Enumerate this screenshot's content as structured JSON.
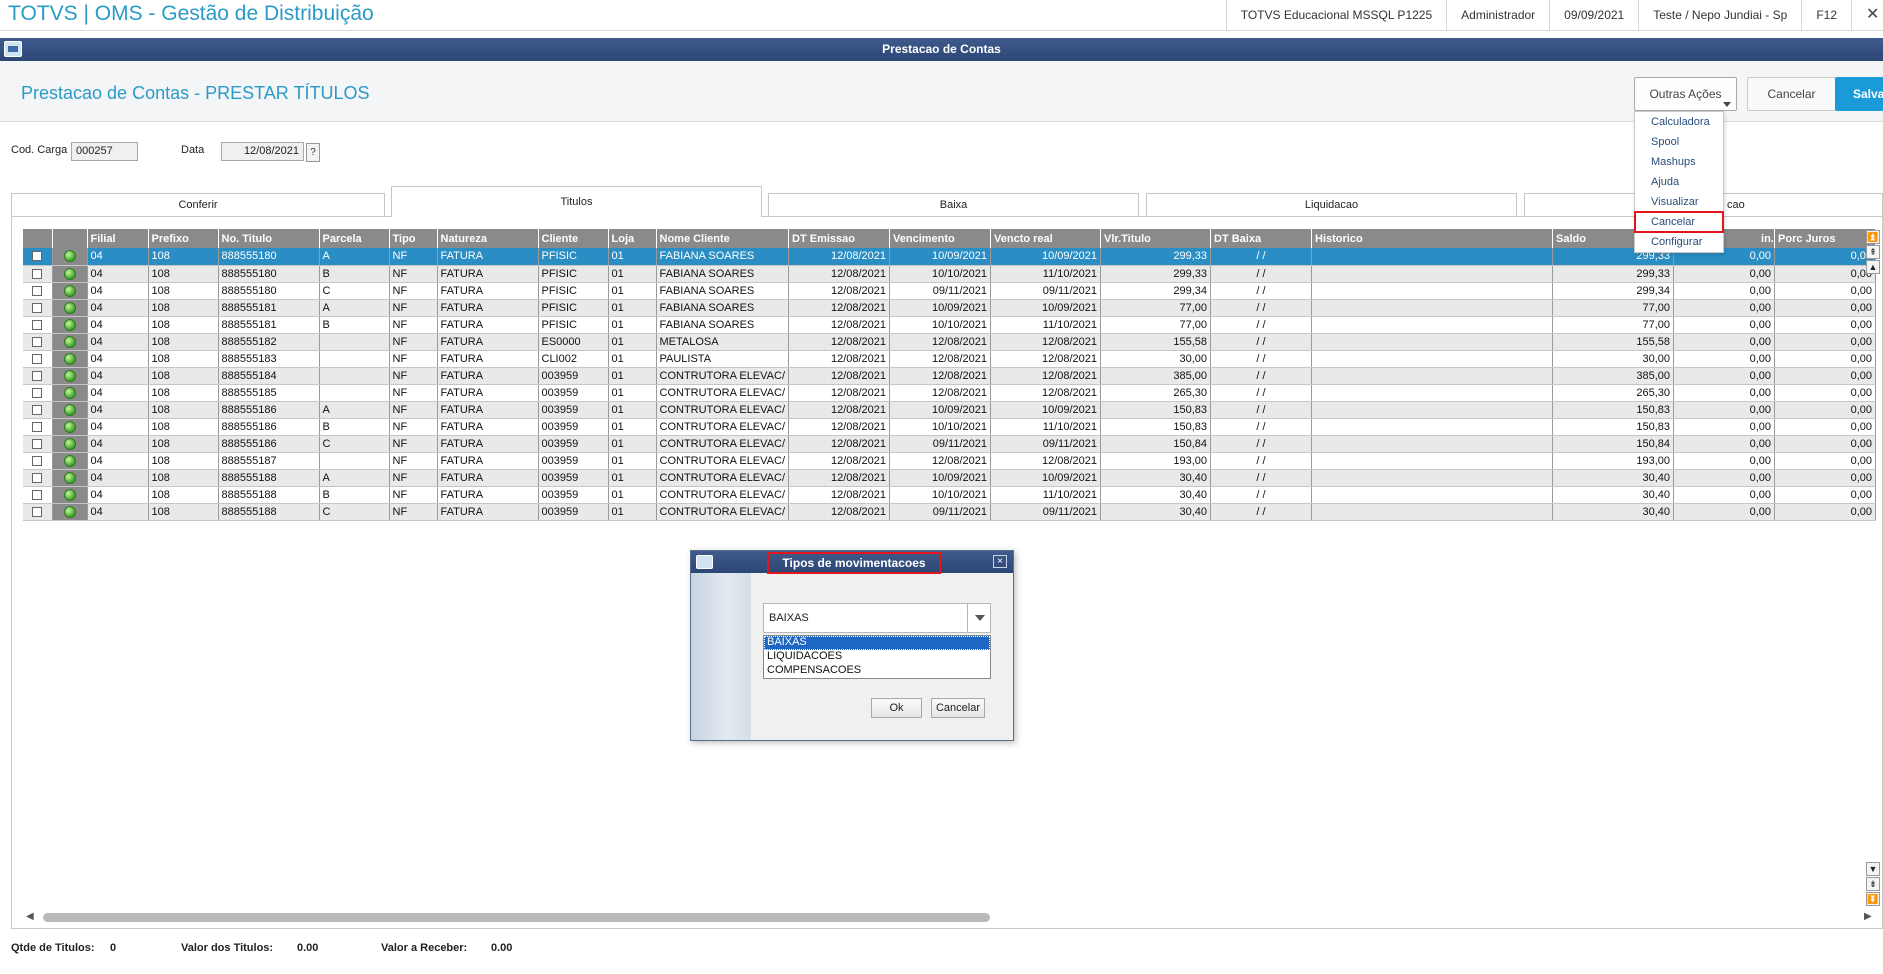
{
  "app": {
    "title": "TOTVS | OMS - Gestão de Distribuição"
  },
  "status_bar": [
    "TOTVS Educacional MSSQL P1225",
    "Administrador",
    "09/09/2021",
    "Teste / Nepo Jundiai - Sp",
    "F12"
  ],
  "window": {
    "title": "Prestacao de Contas"
  },
  "header": {
    "title": "Prestacao de Contas - PRESTAR TÍTULOS",
    "outras_acoes_label": "Outras Ações",
    "cancelar_label": "Cancelar",
    "salvar_label": "Salvar"
  },
  "menu": {
    "items": [
      "Calculadora",
      "Spool",
      "Mashups",
      "Ajuda",
      "Visualizar",
      "Cancelar",
      "Configurar"
    ],
    "highlighted": "Cancelar"
  },
  "form": {
    "cod_carga_label": "Cod. Carga",
    "cod_carga_value": "000257",
    "data_label": "Data",
    "data_value": "12/08/2021",
    "help_label": "?"
  },
  "tabs": [
    {
      "label": "Conferir",
      "active": false
    },
    {
      "label": "Titulos",
      "active": true
    },
    {
      "label": "Baixa",
      "active": false
    },
    {
      "label": "Liquidacao",
      "active": false
    },
    {
      "label": "cao",
      "active": false
    }
  ],
  "grid": {
    "columns": [
      "Filial",
      "Prefixo",
      "No. Titulo",
      "Parcela",
      "Tipo",
      "Natureza",
      "Cliente",
      "Loja",
      "Nome Cliente",
      "DT Emissao",
      "Vencimento",
      "Vencto real",
      "Vlr.Titulo",
      "DT Baixa",
      "Historico",
      "Saldo",
      "in.",
      "Porc Juros"
    ],
    "rows": [
      [
        "04",
        "108",
        "888555180",
        "A",
        "NF",
        "FATURA",
        "PFISIC",
        "01",
        "FABIANA SOARES",
        "12/08/2021",
        "10/09/2021",
        "10/09/2021",
        "299,33",
        " /  /",
        "",
        "299,33",
        "0,00",
        "0,00"
      ],
      [
        "04",
        "108",
        "888555180",
        "B",
        "NF",
        "FATURA",
        "PFISIC",
        "01",
        "FABIANA SOARES",
        "12/08/2021",
        "10/10/2021",
        "11/10/2021",
        "299,33",
        " /  /",
        "",
        "299,33",
        "0,00",
        "0,00"
      ],
      [
        "04",
        "108",
        "888555180",
        "C",
        "NF",
        "FATURA",
        "PFISIC",
        "01",
        "FABIANA SOARES",
        "12/08/2021",
        "09/11/2021",
        "09/11/2021",
        "299,34",
        " /  /",
        "",
        "299,34",
        "0,00",
        "0,00"
      ],
      [
        "04",
        "108",
        "888555181",
        "A",
        "NF",
        "FATURA",
        "PFISIC",
        "01",
        "FABIANA SOARES",
        "12/08/2021",
        "10/09/2021",
        "10/09/2021",
        "77,00",
        " /  /",
        "",
        "77,00",
        "0,00",
        "0,00"
      ],
      [
        "04",
        "108",
        "888555181",
        "B",
        "NF",
        "FATURA",
        "PFISIC",
        "01",
        "FABIANA SOARES",
        "12/08/2021",
        "10/10/2021",
        "11/10/2021",
        "77,00",
        " /  /",
        "",
        "77,00",
        "0,00",
        "0,00"
      ],
      [
        "04",
        "108",
        "888555182",
        "",
        "NF",
        "FATURA",
        "ES0000",
        "01",
        "METALOSA",
        "12/08/2021",
        "12/08/2021",
        "12/08/2021",
        "155,58",
        " /  /",
        "",
        "155,58",
        "0,00",
        "0,00"
      ],
      [
        "04",
        "108",
        "888555183",
        "",
        "NF",
        "FATURA",
        "CLI002",
        "01",
        "PAULISTA",
        "12/08/2021",
        "12/08/2021",
        "12/08/2021",
        "30,00",
        " /  /",
        "",
        "30,00",
        "0,00",
        "0,00"
      ],
      [
        "04",
        "108",
        "888555184",
        "",
        "NF",
        "FATURA",
        "003959",
        "01",
        "CONTRUTORA ELEVAC/",
        "12/08/2021",
        "12/08/2021",
        "12/08/2021",
        "385,00",
        " /  /",
        "",
        "385,00",
        "0,00",
        "0,00"
      ],
      [
        "04",
        "108",
        "888555185",
        "",
        "NF",
        "FATURA",
        "003959",
        "01",
        "CONTRUTORA ELEVAC/",
        "12/08/2021",
        "12/08/2021",
        "12/08/2021",
        "265,30",
        " /  /",
        "",
        "265,30",
        "0,00",
        "0,00"
      ],
      [
        "04",
        "108",
        "888555186",
        "A",
        "NF",
        "FATURA",
        "003959",
        "01",
        "CONTRUTORA ELEVAC/",
        "12/08/2021",
        "10/09/2021",
        "10/09/2021",
        "150,83",
        " /  /",
        "",
        "150,83",
        "0,00",
        "0,00"
      ],
      [
        "04",
        "108",
        "888555186",
        "B",
        "NF",
        "FATURA",
        "003959",
        "01",
        "CONTRUTORA ELEVAC/",
        "12/08/2021",
        "10/10/2021",
        "11/10/2021",
        "150,83",
        " /  /",
        "",
        "150,83",
        "0,00",
        "0,00"
      ],
      [
        "04",
        "108",
        "888555186",
        "C",
        "NF",
        "FATURA",
        "003959",
        "01",
        "CONTRUTORA ELEVAC/",
        "12/08/2021",
        "09/11/2021",
        "09/11/2021",
        "150,84",
        " /  /",
        "",
        "150,84",
        "0,00",
        "0,00"
      ],
      [
        "04",
        "108",
        "888555187",
        "",
        "NF",
        "FATURA",
        "003959",
        "01",
        "CONTRUTORA ELEVAC/",
        "12/08/2021",
        "12/08/2021",
        "12/08/2021",
        "193,00",
        " /  /",
        "",
        "193,00",
        "0,00",
        "0,00"
      ],
      [
        "04",
        "108",
        "888555188",
        "A",
        "NF",
        "FATURA",
        "003959",
        "01",
        "CONTRUTORA ELEVAC/",
        "12/08/2021",
        "10/09/2021",
        "10/09/2021",
        "30,40",
        " /  /",
        "",
        "30,40",
        "0,00",
        "0,00"
      ],
      [
        "04",
        "108",
        "888555188",
        "B",
        "NF",
        "FATURA",
        "003959",
        "01",
        "CONTRUTORA ELEVAC/",
        "12/08/2021",
        "10/10/2021",
        "11/10/2021",
        "30,40",
        " /  /",
        "",
        "30,40",
        "0,00",
        "0,00"
      ],
      [
        "04",
        "108",
        "888555188",
        "C",
        "NF",
        "FATURA",
        "003959",
        "01",
        "CONTRUTORA ELEVAC/",
        "12/08/2021",
        "09/11/2021",
        "09/11/2021",
        "30,40",
        " /  /",
        "",
        "30,40",
        "0,00",
        "0,00"
      ]
    ],
    "selected_row": 0,
    "status_color": "#3ea22b"
  },
  "footer": {
    "qtde_label": "Qtde de Titulos:",
    "qtde_value": "0",
    "valor_titulos_label": "Valor dos Titulos:",
    "valor_titulos_value": "0.00",
    "valor_receber_label": "Valor a Receber:",
    "valor_receber_value": "0.00"
  },
  "dialog": {
    "title": "Tipos de movimentacoes",
    "close_label": "×",
    "selected_value": "BAIXAS",
    "options": [
      "BAIXAS",
      "LIQUIDACOES",
      "COMPENSACOES"
    ],
    "ok_label": "Ok",
    "cancel_label": "Cancelar"
  },
  "colors": {
    "accent": "#2a9bc6",
    "title_bar": "#2c4676",
    "highlight_box": "#e0161b",
    "save_button": "#1a9ad6",
    "selected_row": "#2a8ec4"
  }
}
